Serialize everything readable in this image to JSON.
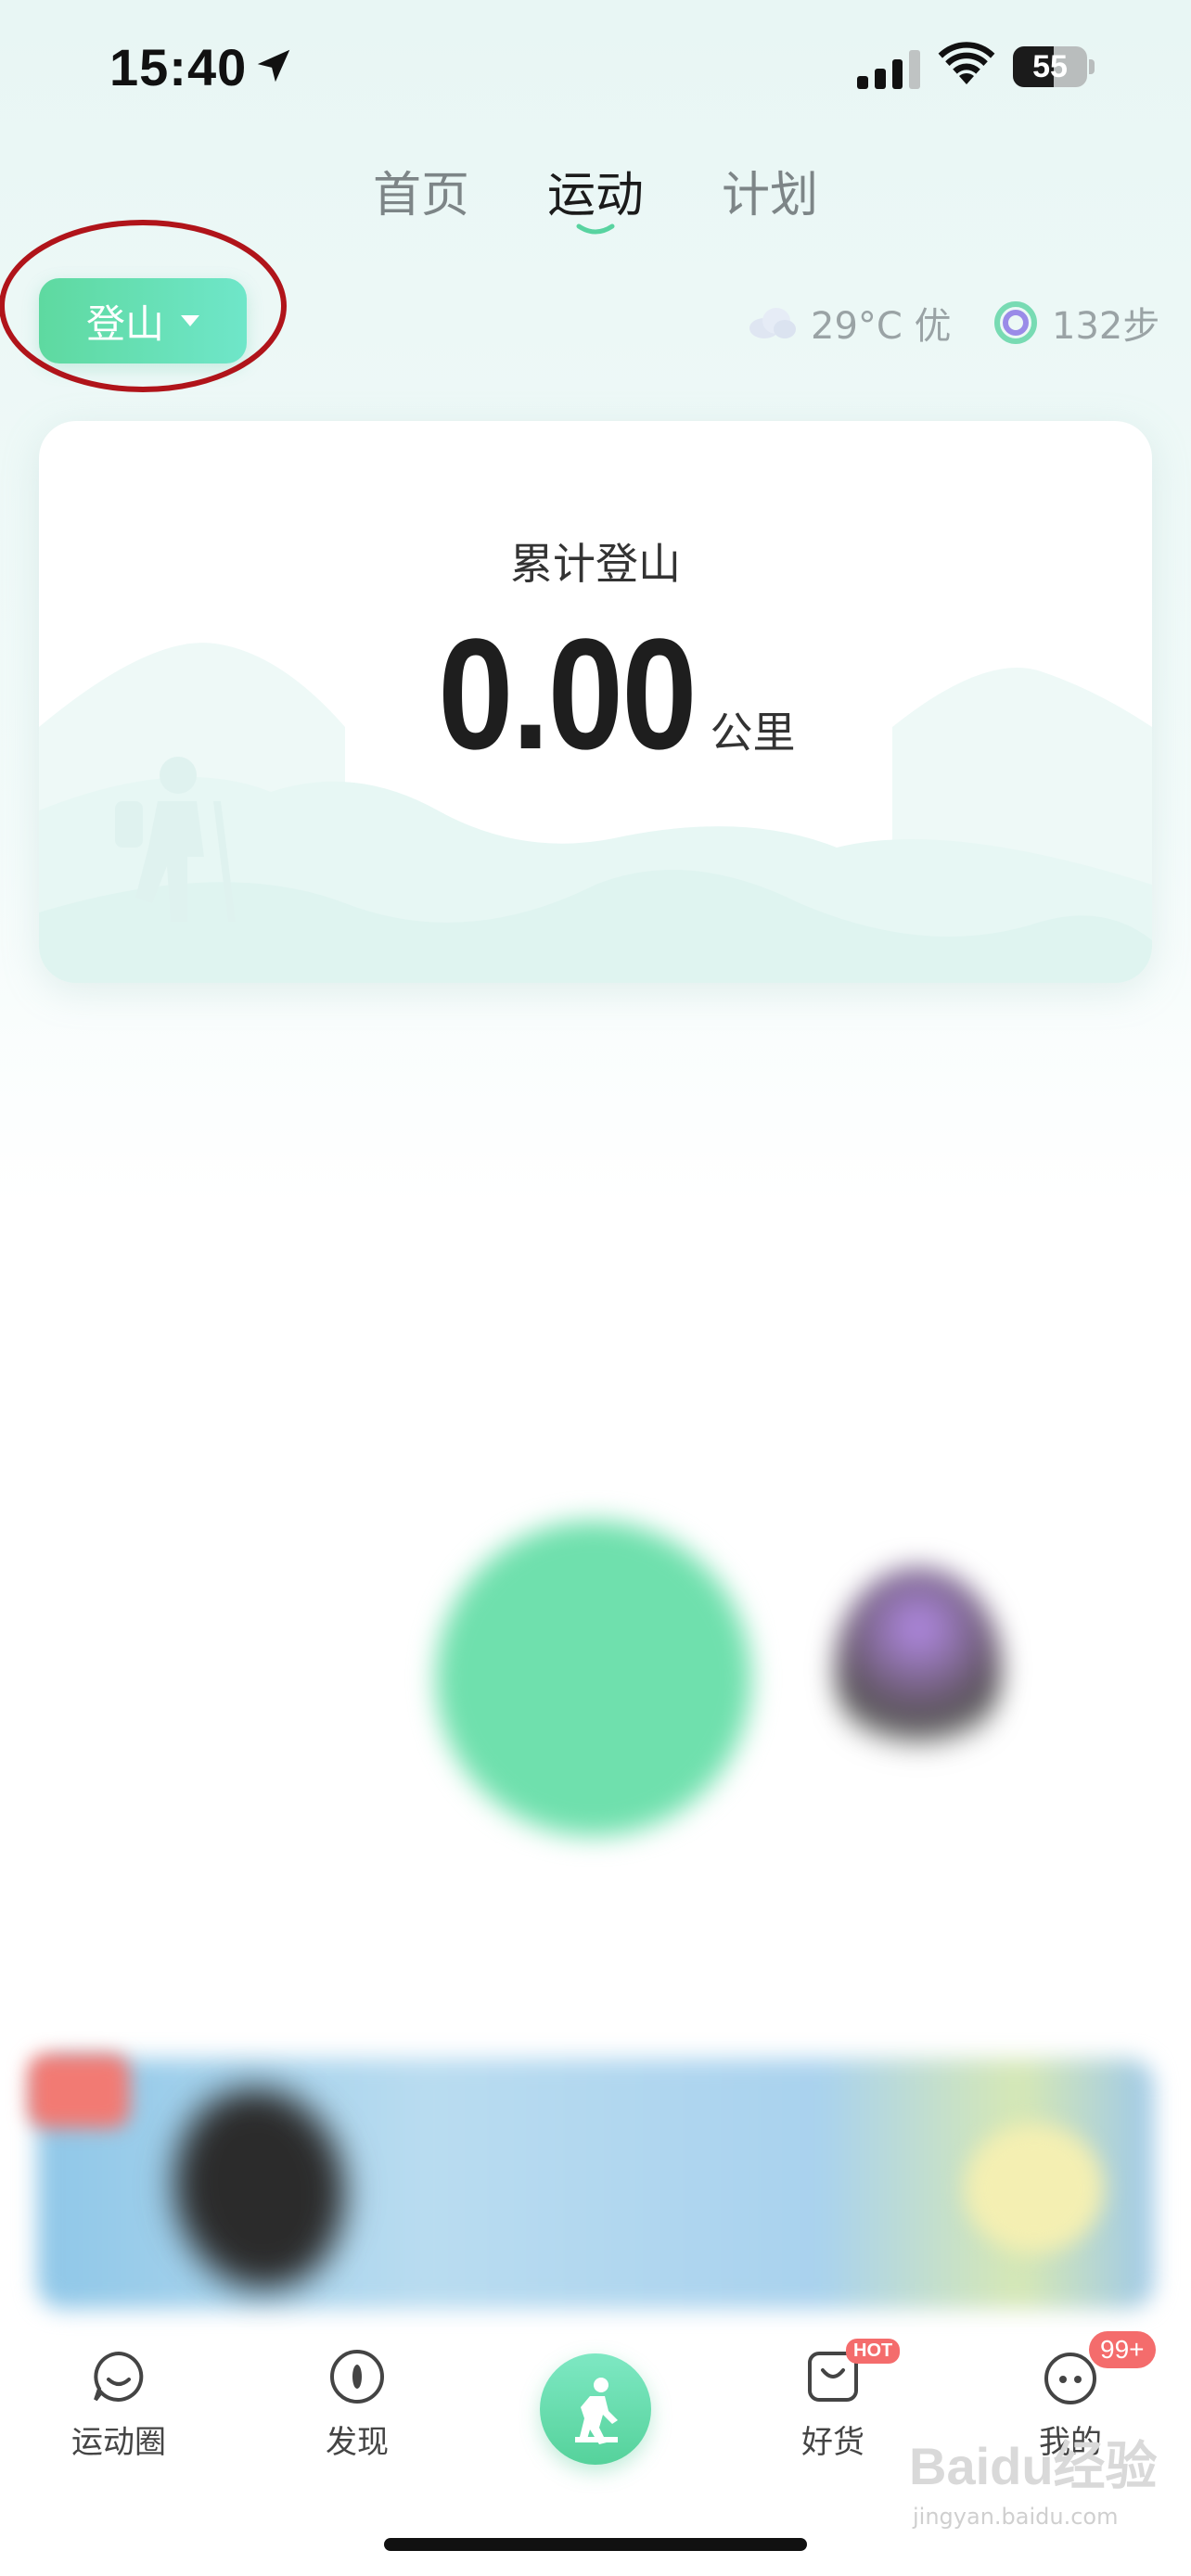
{
  "status_bar": {
    "time": "15:40",
    "battery": "55",
    "battery_level": 0.55
  },
  "top_tabs": [
    {
      "label": "首页",
      "active": false
    },
    {
      "label": "运动",
      "active": true
    },
    {
      "label": "计划",
      "active": false
    }
  ],
  "sport_selector": {
    "label": "登山"
  },
  "weather": {
    "text": "29°C 优",
    "icon": "cloud-icon"
  },
  "steps": {
    "text": "132步",
    "icon": "ring-icon"
  },
  "summary_card": {
    "title": "累计登山",
    "value": "0.00",
    "unit": "公里"
  },
  "bottom_nav": [
    {
      "label": "运动圈",
      "icon": "chat-bubble-icon"
    },
    {
      "label": "发现",
      "icon": "compass-icon"
    },
    {
      "label": "",
      "icon": "hiking-icon"
    },
    {
      "label": "好货",
      "icon": "shopping-bag-icon",
      "badge": "HOT"
    },
    {
      "label": "我的",
      "icon": "profile-icon",
      "badge": "99+"
    }
  ],
  "watermark": {
    "text": "Baidu经验",
    "sub": "jingyan.baidu.com"
  },
  "colors": {
    "accent": "#5ed9a0",
    "annotation": "#b0141a",
    "badge": "#f46c6c"
  }
}
